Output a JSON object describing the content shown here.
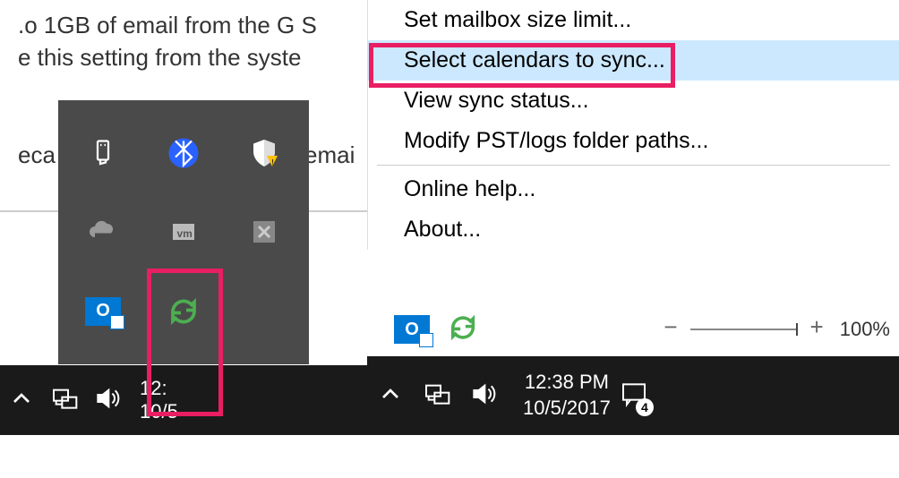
{
  "document": {
    "line1": ".o 1GB of email from the G S",
    "line2": "e this setting from the syste",
    "line3": "eca",
    "emai": "emai"
  },
  "context_menu": {
    "items": [
      {
        "label": "Set mailbox size limit...",
        "highlighted": false
      },
      {
        "label": "Select calendars to sync...",
        "highlighted": true
      },
      {
        "label": "View sync status...",
        "highlighted": false
      },
      {
        "label": "Modify PST/logs folder paths...",
        "highlighted": false
      }
    ],
    "items2": [
      {
        "label": "Online help...",
        "highlighted": false
      },
      {
        "label": "About...",
        "highlighted": false
      }
    ]
  },
  "zoom": {
    "percent": "100%"
  },
  "taskbar_left": {
    "time": "12:",
    "date": "10/5"
  },
  "taskbar_right": {
    "time": "12:38 PM",
    "date": "10/5/2017",
    "notifications": "4"
  },
  "tray_icons": {
    "outlook_letter": "O"
  }
}
